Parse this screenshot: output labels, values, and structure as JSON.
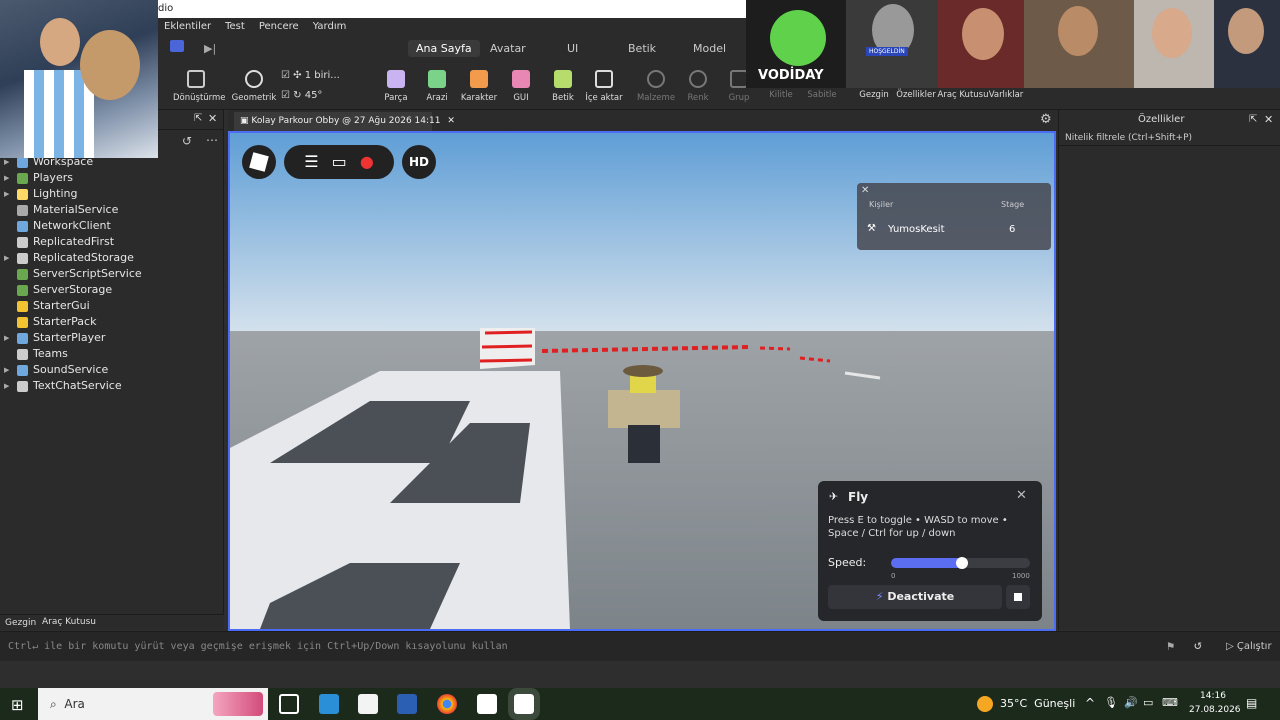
{
  "window": {
    "title_fragment": "dio"
  },
  "menu": [
    "Eklentiler",
    "Test",
    "Pencere",
    "Yardım"
  ],
  "ribbon_tabs": [
    "Ana Sayfa",
    "Avatar",
    "UI",
    "Betik",
    "Model"
  ],
  "toolbar": {
    "items": [
      {
        "label": "Dönüştürme"
      },
      {
        "label": "Geometrik"
      },
      {
        "label": "Parça"
      },
      {
        "label": "Arazi"
      },
      {
        "label": "Karakter"
      },
      {
        "label": "GUI"
      },
      {
        "label": "Betik"
      },
      {
        "label": "İçe aktar"
      },
      {
        "label": "Malzeme"
      },
      {
        "label": "Renk"
      },
      {
        "label": "Grup"
      },
      {
        "label": "Kilitle"
      },
      {
        "label": "Sabitle"
      },
      {
        "label": "Gezgin"
      },
      {
        "label": "Özellikler"
      },
      {
        "label": "Araç Kutusu"
      },
      {
        "label": "Varlıklar"
      }
    ],
    "move_step": "1 biri...",
    "rotate_step": "45°"
  },
  "explorer": {
    "items": [
      {
        "label": "Workspace",
        "expandable": true,
        "color": "#6fa8dc"
      },
      {
        "label": "Players",
        "expandable": true,
        "color": "#6aa84f"
      },
      {
        "label": "Lighting",
        "expandable": true,
        "color": "#ffd966"
      },
      {
        "label": "MaterialService",
        "expandable": false,
        "color": "#aaaaaa"
      },
      {
        "label": "NetworkClient",
        "expandable": false,
        "color": "#6fa8dc"
      },
      {
        "label": "ReplicatedFirst",
        "expandable": false,
        "color": "#cccccc"
      },
      {
        "label": "ReplicatedStorage",
        "expandable": true,
        "color": "#cccccc"
      },
      {
        "label": "ServerScriptService",
        "expandable": false,
        "color": "#6aa84f"
      },
      {
        "label": "ServerStorage",
        "expandable": false,
        "color": "#6aa84f"
      },
      {
        "label": "StarterGui",
        "expandable": false,
        "color": "#f1c232"
      },
      {
        "label": "StarterPack",
        "expandable": false,
        "color": "#f1c232"
      },
      {
        "label": "StarterPlayer",
        "expandable": true,
        "color": "#6fa8dc"
      },
      {
        "label": "Teams",
        "expandable": false,
        "color": "#cccccc"
      },
      {
        "label": "SoundService",
        "expandable": true,
        "color": "#6fa8dc"
      },
      {
        "label": "TextChatService",
        "expandable": true,
        "color": "#cccccc"
      }
    ]
  },
  "bottom_tabs": [
    "Gezgin",
    "Araç Kutusu"
  ],
  "doc_tab": {
    "label": "Kolay Parkour Obby @ 27 Ağu 2026 14:11"
  },
  "properties": {
    "title": "Özellikler",
    "filter_placeholder": "Nitelik filtrele (Ctrl+Shift+P)"
  },
  "game": {
    "hd_label": "HD",
    "leaderboard": {
      "col_player": "Kişiler",
      "col_stat": "Stage",
      "player": "YumosKesit",
      "stage": "6"
    },
    "fly": {
      "title": "Fly",
      "description": "Press E to toggle • WASD to move • Space / Ctrl for up / down",
      "speed_label": "Speed:",
      "speed_min": "0",
      "speed_max": "1000",
      "speed_fraction": 0.51,
      "button": "Deactivate"
    }
  },
  "command_bar": {
    "placeholder": "Ctrl↵ ile bir komutu yürüt veya geçmişe erişmek için Ctrl+Up/Down kısayolunu kullan",
    "run_label": "Çalıştır"
  },
  "stream_overlay": {
    "label": "VODİDAY",
    "welcome": "HOŞGELDİN"
  },
  "taskbar": {
    "search": "Ara",
    "weather": "35°C  Güneşli",
    "time": "14:16",
    "date": "27.08.2026"
  }
}
